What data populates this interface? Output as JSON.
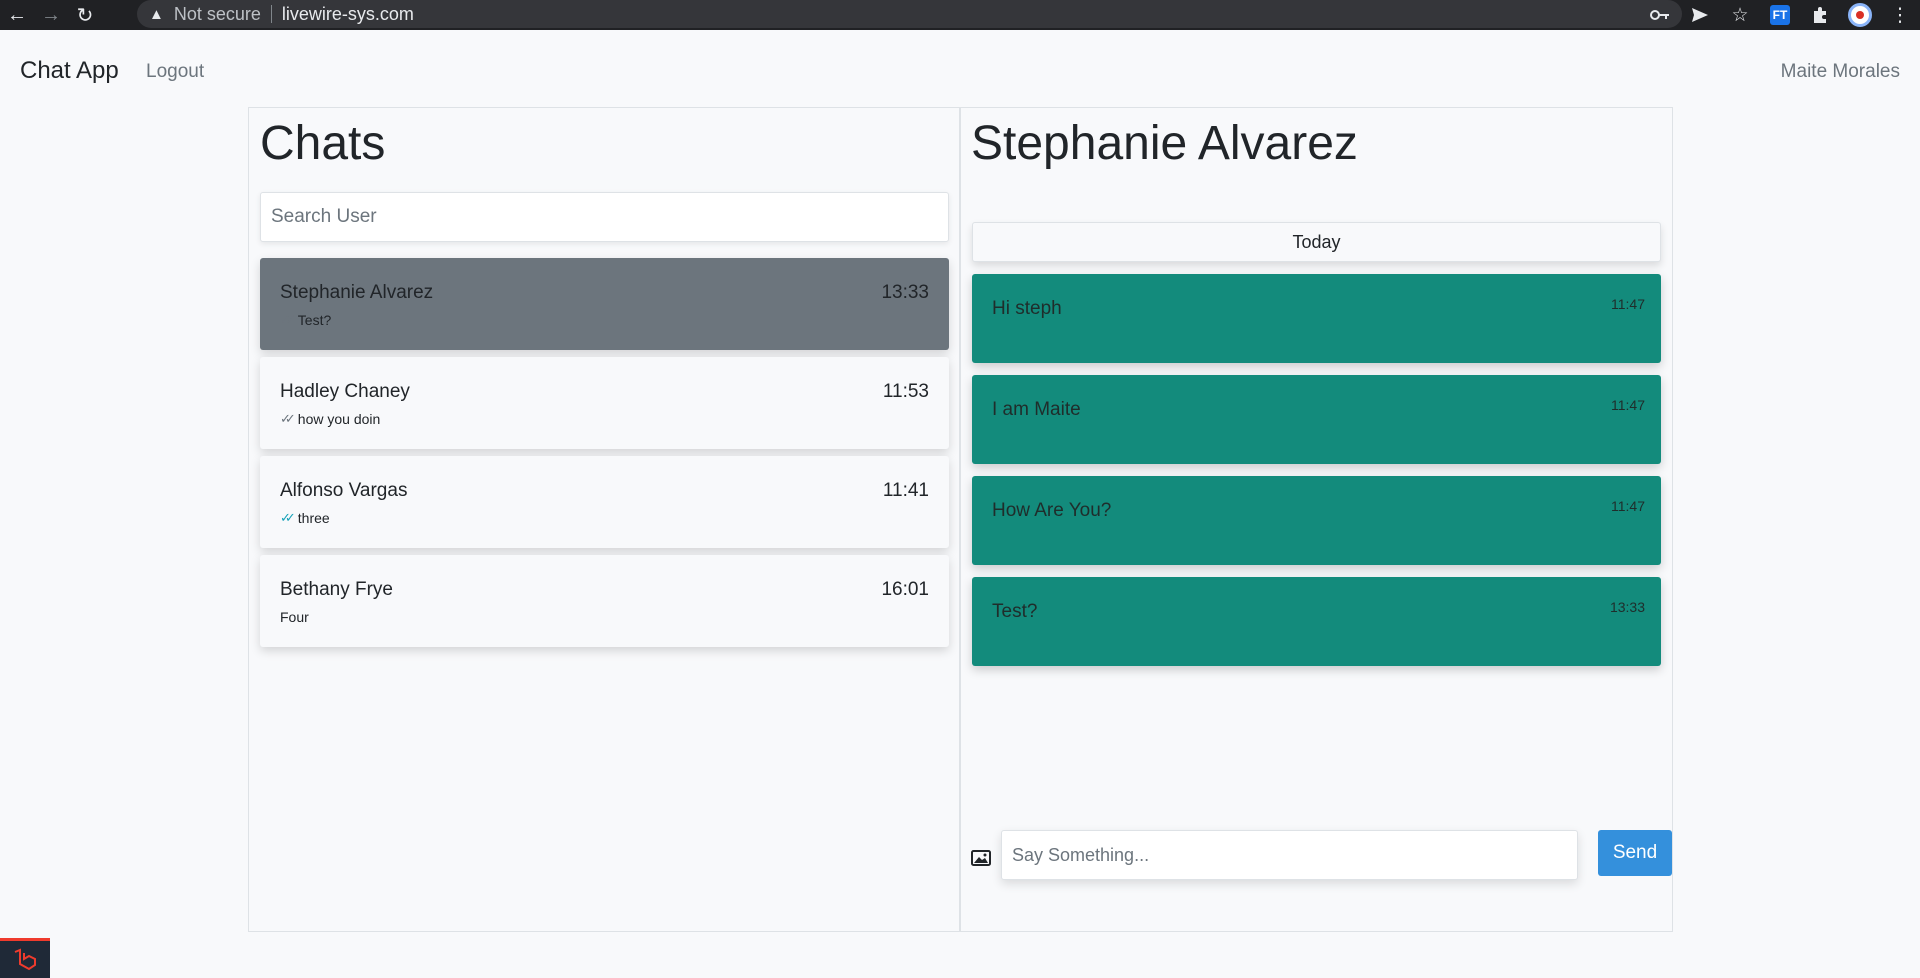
{
  "browser": {
    "address_warning": "Not secure",
    "url": "livewire-sys.com",
    "extension_label": "FT"
  },
  "navbar": {
    "brand": "Chat App",
    "logout": "Logout",
    "user": "Maite Morales"
  },
  "sidebar": {
    "title": "Chats",
    "search_placeholder": "Search User",
    "chats": [
      {
        "name": "Stephanie Alvarez",
        "time": "13:33",
        "last": "Test?",
        "status": "sent",
        "active": true
      },
      {
        "name": "Hadley Chaney",
        "time": "11:53",
        "last": "how you doin",
        "status": "sent",
        "active": false
      },
      {
        "name": "Alfonso Vargas",
        "time": "11:41",
        "last": "three",
        "status": "read",
        "active": false
      },
      {
        "name": "Bethany Frye",
        "time": "16:01",
        "last": "Four",
        "status": "none",
        "active": false
      }
    ]
  },
  "conversation": {
    "title": "Stephanie Alvarez",
    "date_divider": "Today",
    "messages": [
      {
        "text": "Hi steph",
        "time": "11:47"
      },
      {
        "text": "I am Maite",
        "time": "11:47"
      },
      {
        "text": "How Are You?",
        "time": "11:47"
      },
      {
        "text": "Test?",
        "time": "13:33"
      }
    ],
    "input_placeholder": "Say Something...",
    "send_label": "Send"
  },
  "colors": {
    "active_chat": "#6c757d",
    "message_bg": "#138b7c",
    "send_button": "#3490dc",
    "read_tick": "#17a2b8"
  }
}
